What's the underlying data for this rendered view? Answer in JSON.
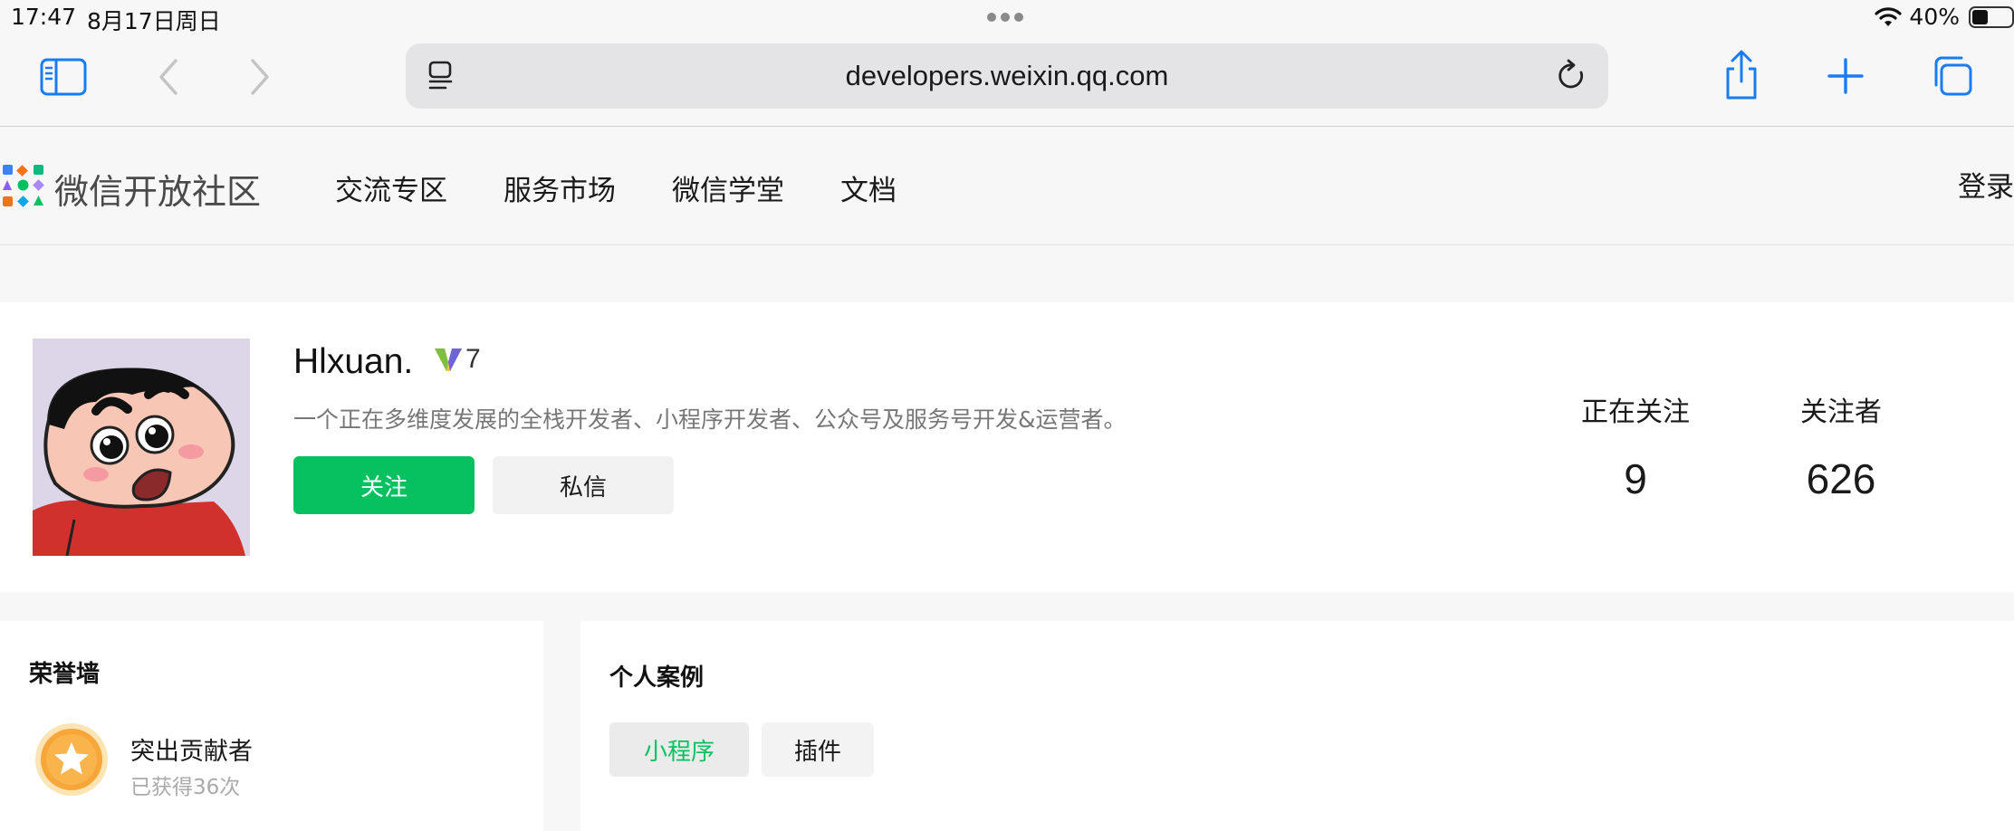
{
  "status_bar": {
    "time": "17:47",
    "date": "8月17日周日",
    "battery_percent": "40%",
    "battery_level": 0.4
  },
  "browser": {
    "url": "developers.weixin.qq.com",
    "accent_color": "#1a7cf2"
  },
  "site": {
    "name": "微信开放社区",
    "nav": [
      "交流专区",
      "服务市场",
      "微信学堂",
      "文档"
    ],
    "login": "登录"
  },
  "profile": {
    "name": "Hlxuan.",
    "level": "7",
    "bio": "一个正在多维度发展的全栈开发者、小程序开发者、公众号及服务号开发&运营者。",
    "follow_label": "关注",
    "message_label": "私信",
    "following_label": "正在关注",
    "following_count": "9",
    "followers_label": "关注者",
    "followers_count": "626",
    "brand_color": "#07c160"
  },
  "honor_wall": {
    "title": "荣誉墙",
    "badge_name": "突出贡献者",
    "badge_count": "已获得36次",
    "badge_icon": "star-medal-icon"
  },
  "cases": {
    "title": "个人案例",
    "tabs": [
      "小程序",
      "插件"
    ],
    "active_tab": "小程序"
  }
}
